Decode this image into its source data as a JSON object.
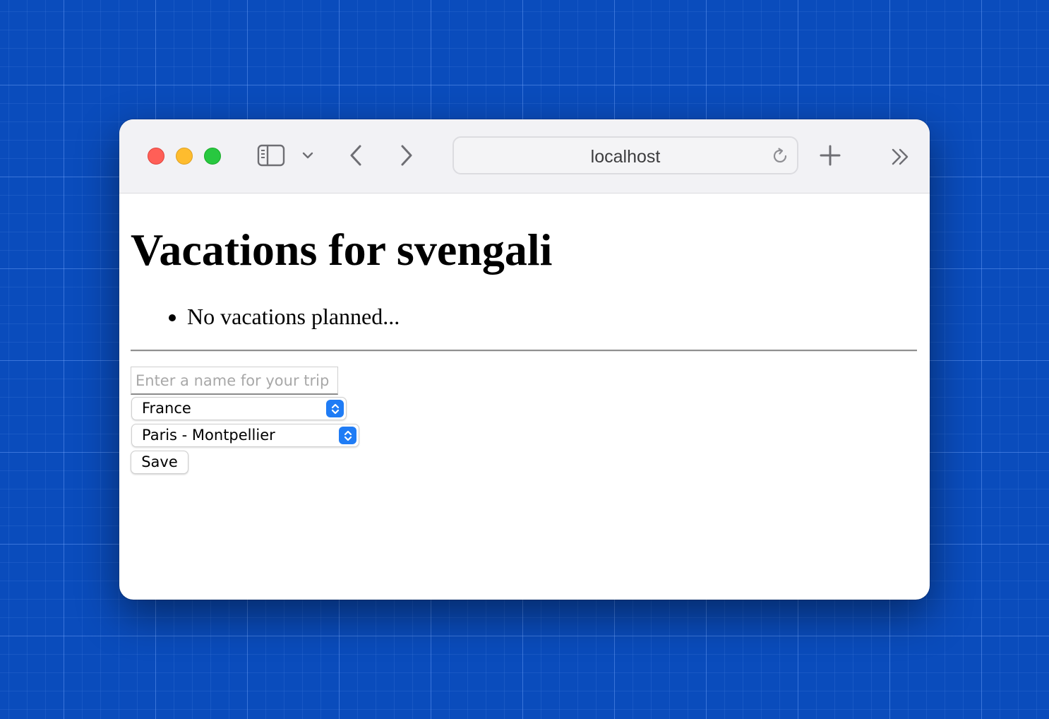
{
  "browser": {
    "address": "localhost",
    "icons": {
      "sidebar": "sidebar-icon",
      "tab_overview": "chevron-down-icon",
      "back": "chevron-left-icon",
      "forward": "chevron-right-icon",
      "reload": "reload-icon",
      "new_tab": "plus-icon",
      "more": "double-chevron-right-icon"
    },
    "traffic_lights": {
      "close": "#ff5f57",
      "minimize": "#febc2e",
      "maximize": "#28c840"
    }
  },
  "page": {
    "title": "Vacations for svengali",
    "vacations": [
      "No vacations planned..."
    ],
    "form": {
      "trip_name_placeholder": "Enter a name for your trip",
      "trip_name_value": "",
      "country_selected": "France",
      "route_selected": "Paris - Montpellier",
      "save_label": "Save"
    }
  },
  "colors": {
    "background": "#0a4cbc",
    "select_accent": "#1f7cf5"
  }
}
